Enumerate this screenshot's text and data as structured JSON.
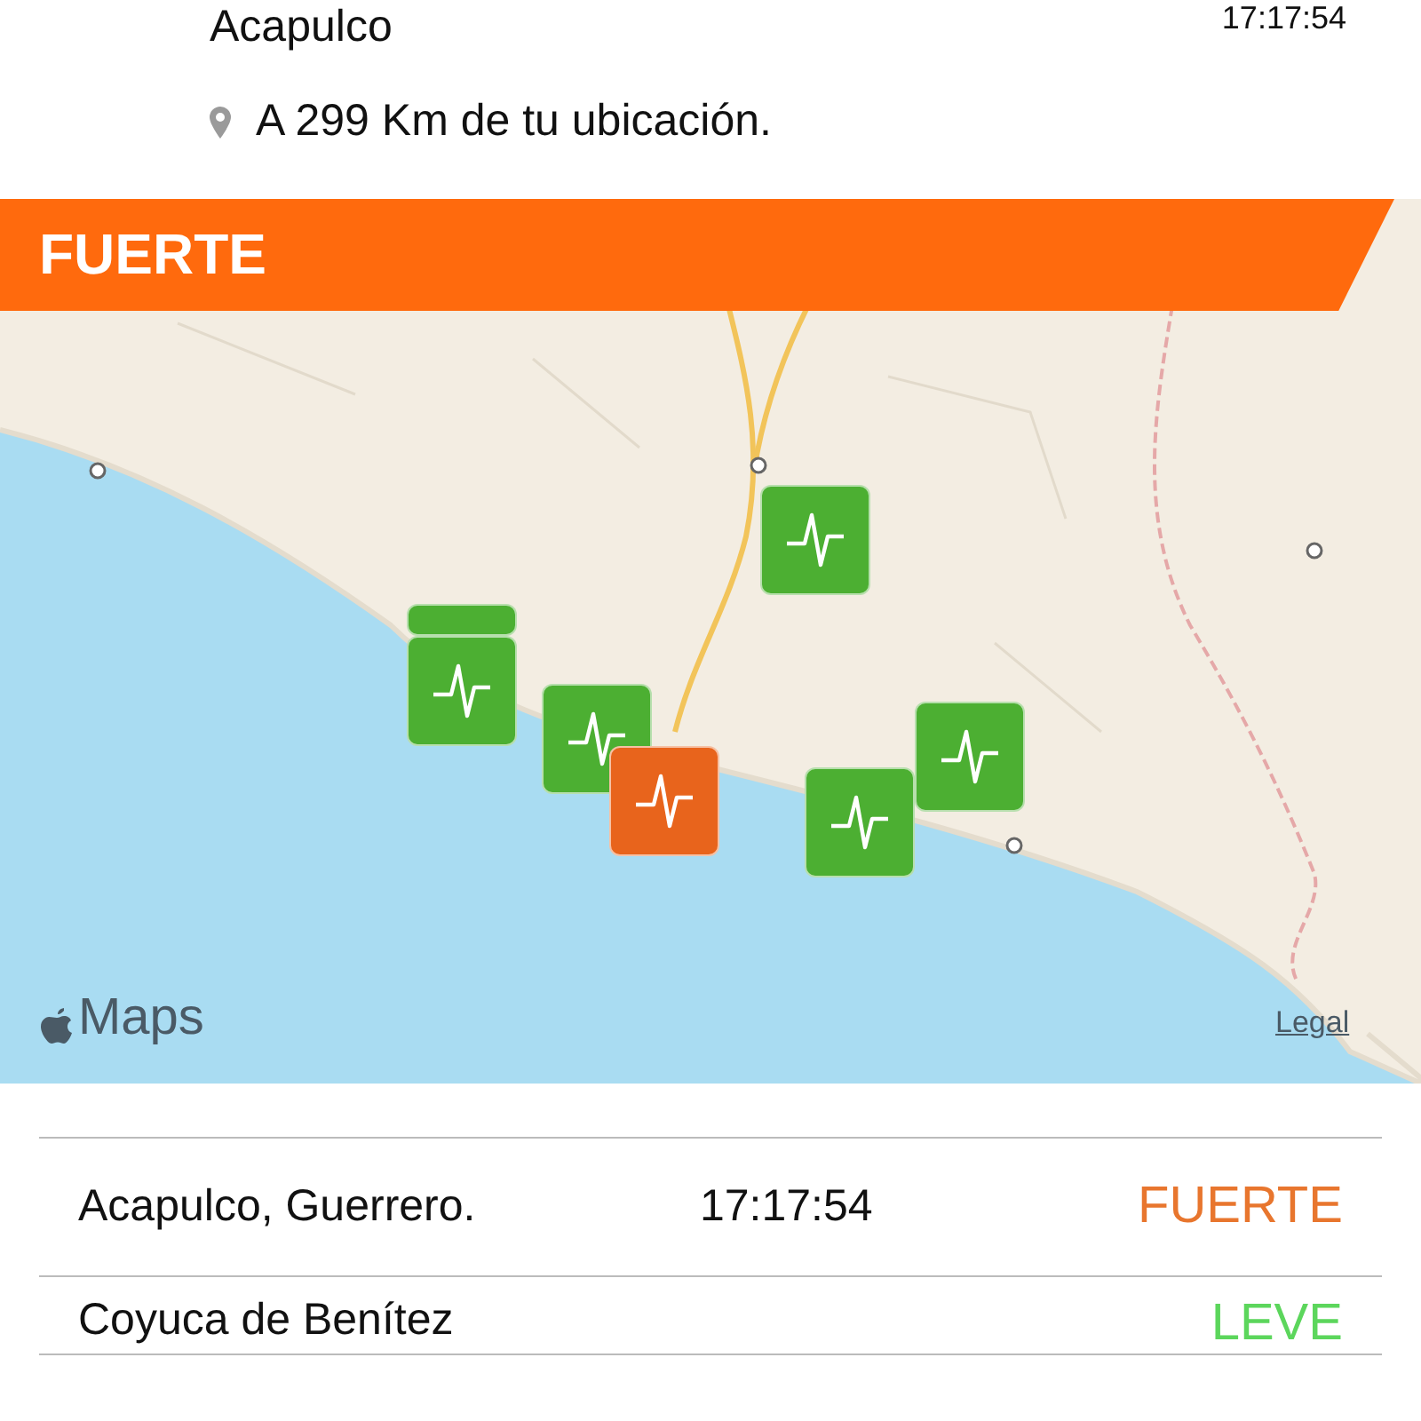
{
  "header": {
    "place": "Acapulco",
    "time": "17:17:54",
    "distance": "A 299 Km de tu ubicación."
  },
  "banner": {
    "label": "FUERTE"
  },
  "map": {
    "attribution": "Maps",
    "legal": "Legal",
    "markers": [
      {
        "color": "#4caf32"
      },
      {
        "color": "#4caf32"
      },
      {
        "color": "#4caf32"
      },
      {
        "color": "#4caf32"
      },
      {
        "color": "#4caf32"
      },
      {
        "color": "#4caf32"
      },
      {
        "color": "#e8641c"
      }
    ]
  },
  "events": [
    {
      "place": "Acapulco, Guerrero.",
      "time": "17:17:54",
      "intensity": "FUERTE",
      "color": "#e8762e"
    },
    {
      "place": "Coyuca de Benítez",
      "intensity": "LEVE",
      "color": "#5cd65c"
    }
  ]
}
